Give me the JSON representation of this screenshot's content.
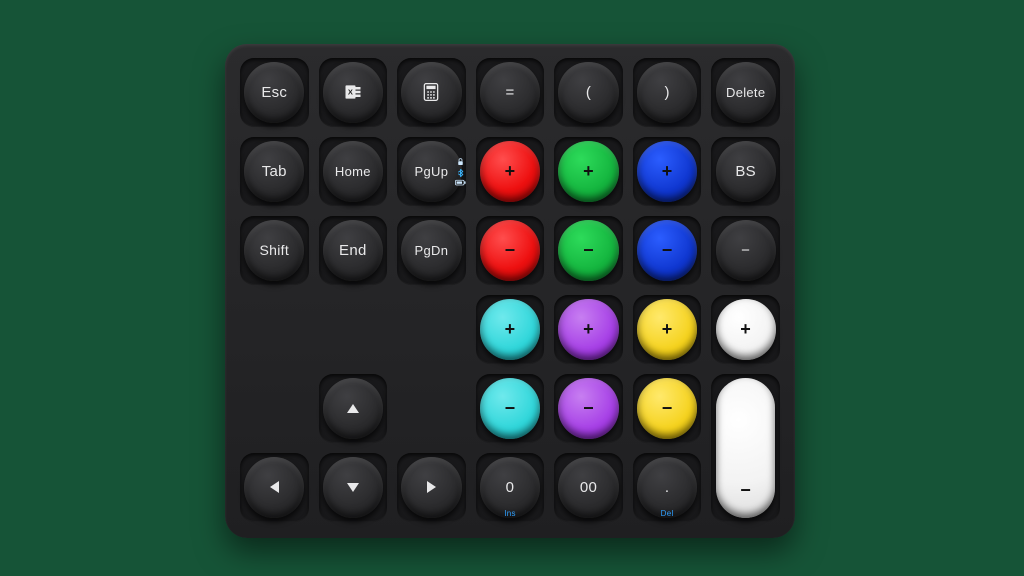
{
  "keys": {
    "esc": "Esc",
    "eq": "=",
    "lp": "(",
    "rp": ")",
    "del": "Delete",
    "tab": "Tab",
    "home": "Home",
    "pgup": "PgUp",
    "bs": "BS",
    "shift": "Shift",
    "end": "End",
    "pgdn": "PgDn",
    "minus": "−",
    "plus": "+",
    "zero": "0",
    "dzero": "00",
    "dot": "."
  },
  "sub": {
    "ins": "Ins",
    "del": "Del"
  },
  "icons": {
    "excel": "excel-icon",
    "calc": "calculator-icon",
    "lock": "numlock-icon",
    "bt": "bluetooth-icon",
    "batt": "battery-icon"
  },
  "color_keys": {
    "r2": [
      {
        "c": "red",
        "t": "+"
      },
      {
        "c": "green",
        "t": "+"
      },
      {
        "c": "blue",
        "t": "+"
      }
    ],
    "r3": [
      {
        "c": "red",
        "t": "−"
      },
      {
        "c": "green",
        "t": "−"
      },
      {
        "c": "blue",
        "t": "−"
      }
    ],
    "r4": [
      {
        "c": "cyan",
        "t": "+"
      },
      {
        "c": "purple",
        "t": "+"
      },
      {
        "c": "yellow",
        "t": "+"
      },
      {
        "c": "white",
        "t": "+"
      }
    ],
    "r5": [
      {
        "c": "cyan",
        "t": "−"
      },
      {
        "c": "purple",
        "t": "−"
      },
      {
        "c": "yellow",
        "t": "−"
      }
    ]
  }
}
